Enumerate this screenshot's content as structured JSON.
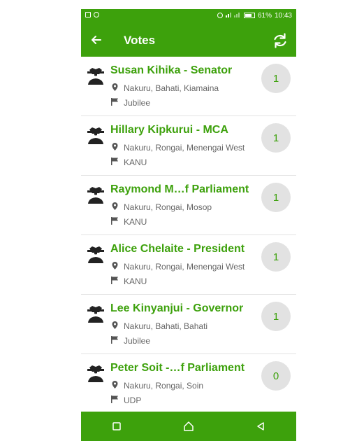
{
  "status": {
    "battery": "61%",
    "time": "10:43"
  },
  "appbar": {
    "title": "Votes"
  },
  "votes": [
    {
      "name": "Susan Kihika - Senator",
      "location": "Nakuru, Bahati, Kiamaina",
      "party": "Jubilee",
      "count": "1"
    },
    {
      "name": "Hillary Kipkurui - MCA",
      "location": "Nakuru, Rongai, Menengai West",
      "party": "KANU",
      "count": "1"
    },
    {
      "name": "Raymond M…f Parliament",
      "location": "Nakuru, Rongai, Mosop",
      "party": "KANU",
      "count": "1"
    },
    {
      "name": "Alice Chelaite - President",
      "location": "Nakuru, Rongai, Menengai West",
      "party": "KANU",
      "count": "1"
    },
    {
      "name": "Lee Kinyanjui - Governor",
      "location": "Nakuru, Bahati, Bahati",
      "party": "Jubilee",
      "count": "1"
    },
    {
      "name": "Peter Soit -…f Parliament",
      "location": "Nakuru, Rongai, Soin",
      "party": "UDP",
      "count": "0"
    }
  ]
}
